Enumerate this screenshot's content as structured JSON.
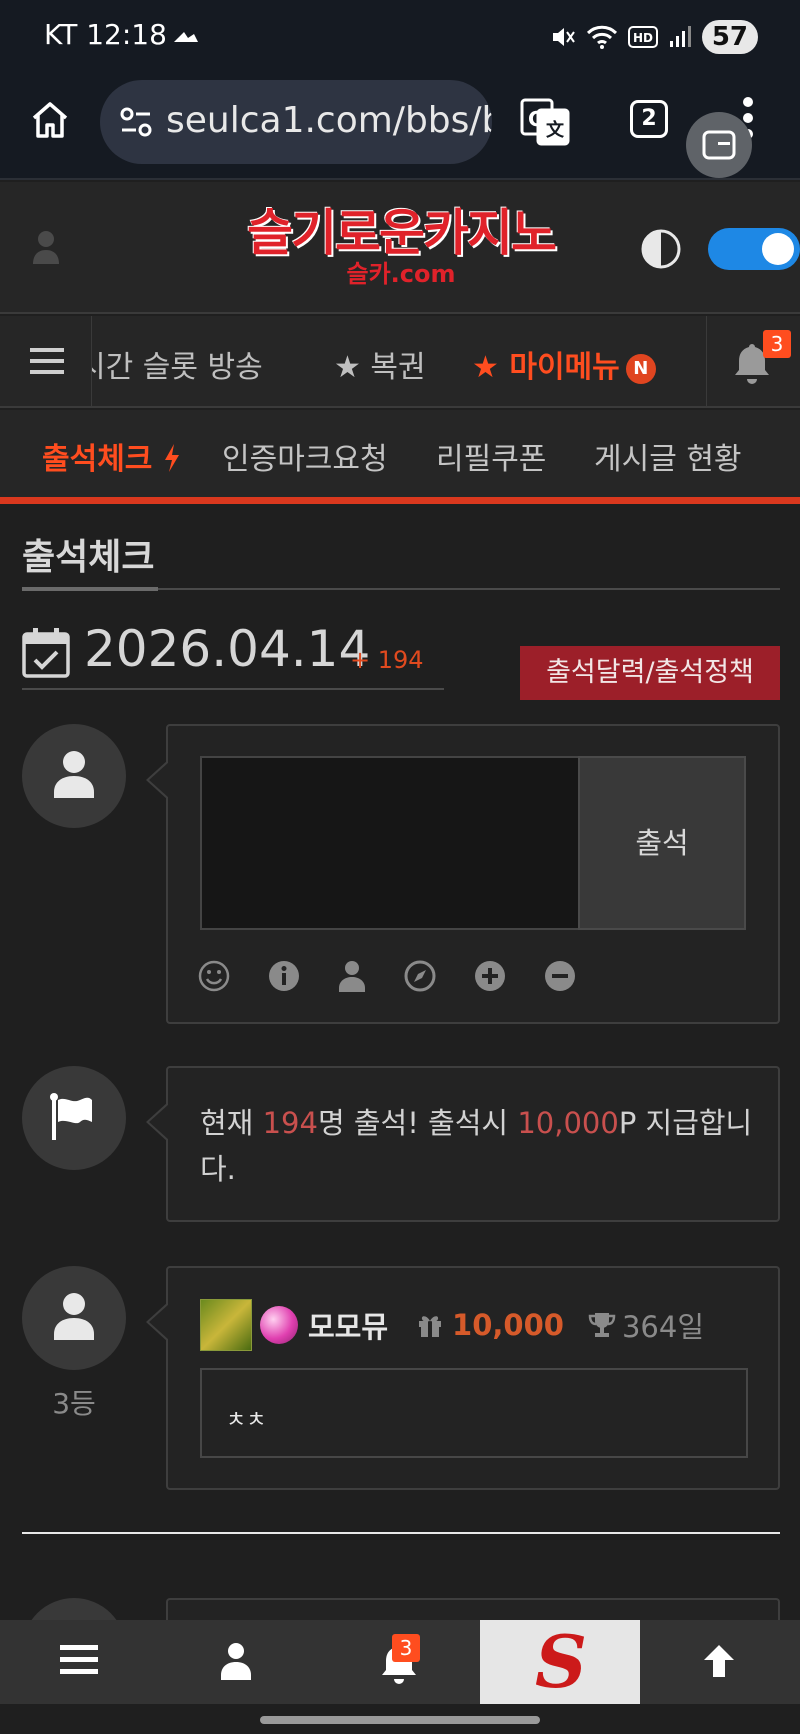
{
  "status_bar": {
    "carrier_time": "KT 12:18",
    "battery": "57"
  },
  "browser": {
    "url": "seulca1.com/bbs/b",
    "tab_count": "2"
  },
  "site": {
    "logo_main": "슬기로운카지노",
    "logo_sub": "슬카.com"
  },
  "nav": {
    "items": [
      {
        "label": "시간 슬롯 방송"
      },
      {
        "label": "★ 복권"
      },
      {
        "label": "★ 마이메뉴"
      }
    ],
    "new_badge": "N",
    "notif_count": "3"
  },
  "subnav": {
    "items": [
      {
        "label": "출석체크"
      },
      {
        "label": "인증마크요청"
      },
      {
        "label": "리필쿠폰"
      },
      {
        "label": "게시글 현황"
      }
    ]
  },
  "page": {
    "title": "출석체크",
    "date": "2026.04.14",
    "count": "+ 194",
    "policy_button": "출석달력/출석정책"
  },
  "checkin": {
    "button": "출석",
    "textarea_value": ""
  },
  "notice": {
    "prefix": "현재 ",
    "count": "194",
    "mid": "명 출석! 출석시 ",
    "points": "10,000",
    "suffix": "P 지급합니다."
  },
  "entry": {
    "rank": "3등",
    "username": "모모뮤",
    "points": "10,000",
    "days": "364일",
    "comment": "ㅊㅊ"
  },
  "bottom_bar": {
    "notif_count": "3",
    "logo": "S"
  },
  "colors": {
    "accent": "#ff4d1f",
    "policy_button": "#9c1f29",
    "highlight": "#c9504e"
  }
}
